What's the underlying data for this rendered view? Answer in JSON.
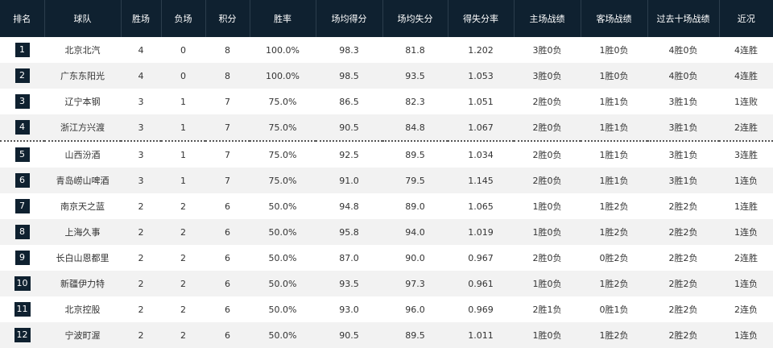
{
  "columns": [
    "排名",
    "球队",
    "胜场",
    "负场",
    "积分",
    "胜率",
    "场均得分",
    "场均失分",
    "得失分率",
    "主场战绩",
    "客场战绩",
    "过去十场战绩",
    "近况"
  ],
  "rows": [
    [
      "1",
      "北京北汽",
      "4",
      "0",
      "8",
      "100.0%",
      "98.3",
      "81.8",
      "1.202",
      "3胜0负",
      "1胜0负",
      "4胜0负",
      "4连胜"
    ],
    [
      "2",
      "广东东阳光",
      "4",
      "0",
      "8",
      "100.0%",
      "98.5",
      "93.5",
      "1.053",
      "3胜0负",
      "1胜0负",
      "4胜0负",
      "4连胜"
    ],
    [
      "3",
      "辽宁本钢",
      "3",
      "1",
      "7",
      "75.0%",
      "86.5",
      "82.3",
      "1.051",
      "2胜0负",
      "1胜1负",
      "3胜1负",
      "1连败"
    ],
    [
      "4",
      "浙江方兴渡",
      "3",
      "1",
      "7",
      "75.0%",
      "90.5",
      "84.8",
      "1.067",
      "2胜0负",
      "1胜1负",
      "3胜1负",
      "2连胜"
    ],
    [
      "5",
      "山西汾酒",
      "3",
      "1",
      "7",
      "75.0%",
      "92.5",
      "89.5",
      "1.034",
      "2胜0负",
      "1胜1负",
      "3胜1负",
      "3连胜"
    ],
    [
      "6",
      "青岛崂山啤酒",
      "3",
      "1",
      "7",
      "75.0%",
      "91.0",
      "79.5",
      "1.145",
      "2胜0负",
      "1胜1负",
      "3胜1负",
      "1连负"
    ],
    [
      "7",
      "南京天之蓝",
      "2",
      "2",
      "6",
      "50.0%",
      "94.8",
      "89.0",
      "1.065",
      "1胜0负",
      "1胜2负",
      "2胜2负",
      "1连胜"
    ],
    [
      "8",
      "上海久事",
      "2",
      "2",
      "6",
      "50.0%",
      "95.8",
      "94.0",
      "1.019",
      "1胜0负",
      "1胜2负",
      "2胜2负",
      "1连负"
    ],
    [
      "9",
      "长白山恩都里",
      "2",
      "2",
      "6",
      "50.0%",
      "87.0",
      "90.0",
      "0.967",
      "2胜0负",
      "0胜2负",
      "2胜2负",
      "2连胜"
    ],
    [
      "10",
      "新疆伊力特",
      "2",
      "2",
      "6",
      "50.0%",
      "93.5",
      "97.3",
      "0.961",
      "1胜0负",
      "1胜2负",
      "2胜2负",
      "1连负"
    ],
    [
      "11",
      "北京控股",
      "2",
      "2",
      "6",
      "50.0%",
      "93.0",
      "96.0",
      "0.969",
      "2胜1负",
      "0胜1负",
      "2胜2负",
      "2连负"
    ],
    [
      "12",
      "宁波町渥",
      "2",
      "2",
      "6",
      "50.0%",
      "90.5",
      "89.5",
      "1.011",
      "1胜0负",
      "1胜2负",
      "2胜2负",
      "1连负"
    ]
  ],
  "colors": {
    "header_bg": "#0f2130",
    "badge_bg": "#0f2130",
    "stripe_bg": "#f2f2f2"
  }
}
